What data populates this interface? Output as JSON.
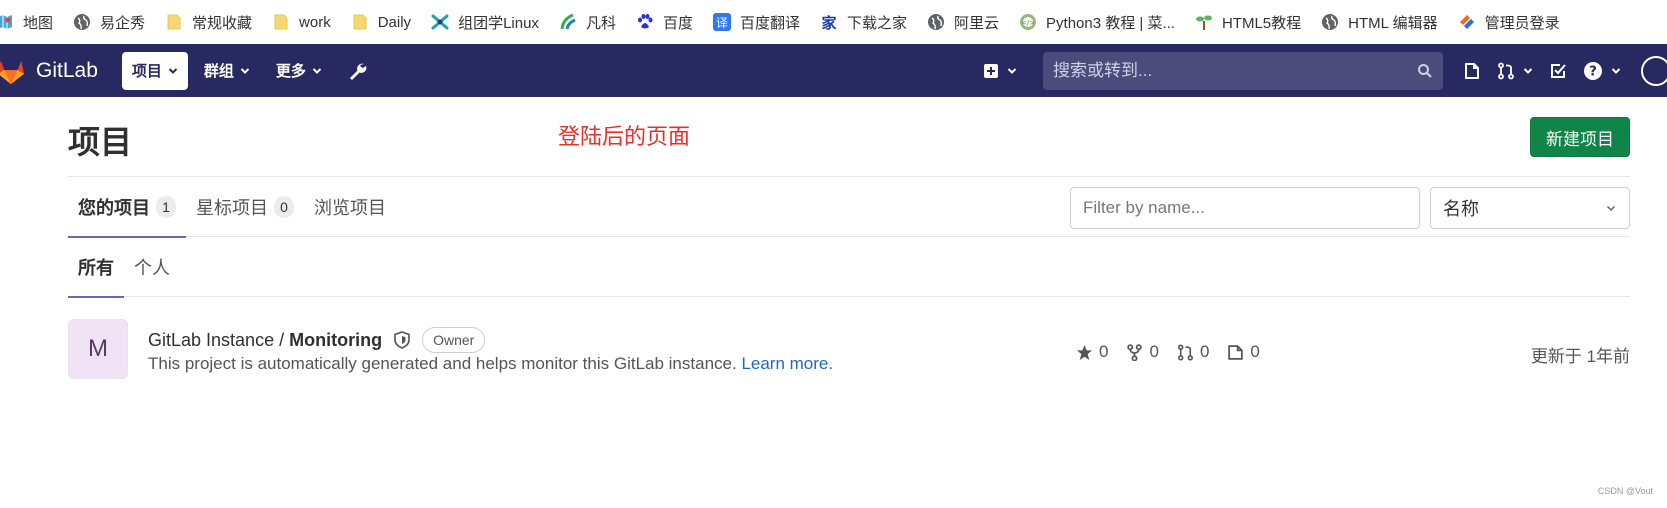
{
  "bookmarks": [
    {
      "label": "地图",
      "icon": "map-icon"
    },
    {
      "label": "易企秀",
      "icon": "globe-icon"
    },
    {
      "label": "常规收藏",
      "icon": "folder-icon"
    },
    {
      "label": "work",
      "icon": "folder-icon"
    },
    {
      "label": "Daily",
      "icon": "folder-icon"
    },
    {
      "label": "组团学Linux",
      "icon": "zutuan-icon"
    },
    {
      "label": "凡科",
      "icon": "fanke-icon"
    },
    {
      "label": "百度",
      "icon": "baidu-paw-icon"
    },
    {
      "label": "百度翻译",
      "icon": "translate-icon"
    },
    {
      "label": "下载之家",
      "icon": "download-home-icon"
    },
    {
      "label": "阿里云",
      "icon": "globe-icon"
    },
    {
      "label": "Python3 教程 | 菜...",
      "icon": "runoob-icon"
    },
    {
      "label": "HTML5教程",
      "icon": "sprout-icon"
    },
    {
      "label": "HTML 编辑器",
      "icon": "globe-icon"
    },
    {
      "label": "管理员登录",
      "icon": "admin-icon"
    }
  ],
  "topnav": {
    "brand": "GitLab",
    "menus": [
      {
        "label": "项目",
        "active": true
      },
      {
        "label": "群组",
        "active": false
      },
      {
        "label": "更多",
        "active": false
      }
    ],
    "search_placeholder": "搜索或转到..."
  },
  "colors": {
    "navbar": "#292961",
    "primary_button": "#108548",
    "link": "#1f68c2",
    "annotation": "#e8302a",
    "tab_underline": "#6666c4"
  },
  "page": {
    "title": "项目",
    "annotation": "登陆后的页面",
    "new_project_label": "新建项目",
    "tabs": [
      {
        "label": "您的项目",
        "count": "1",
        "active": true
      },
      {
        "label": "星标项目",
        "count": "0",
        "active": false
      },
      {
        "label": "浏览项目",
        "count": "",
        "active": false
      }
    ],
    "filter_placeholder": "Filter by name...",
    "sort_selected": "名称",
    "subtabs": [
      {
        "label": "所有",
        "active": true
      },
      {
        "label": "个人",
        "active": false
      }
    ]
  },
  "project": {
    "avatar_letter": "M",
    "namespace": "GitLab Instance /",
    "name": "Monitoring",
    "role_badge": "Owner",
    "description": "This project is automatically generated and helps monitor this GitLab instance.",
    "learn_more": "Learn more.",
    "stars": "0",
    "forks": "0",
    "merge_requests": "0",
    "issues": "0",
    "updated": "更新于 1年前"
  },
  "watermark": "CSDN @Vout"
}
